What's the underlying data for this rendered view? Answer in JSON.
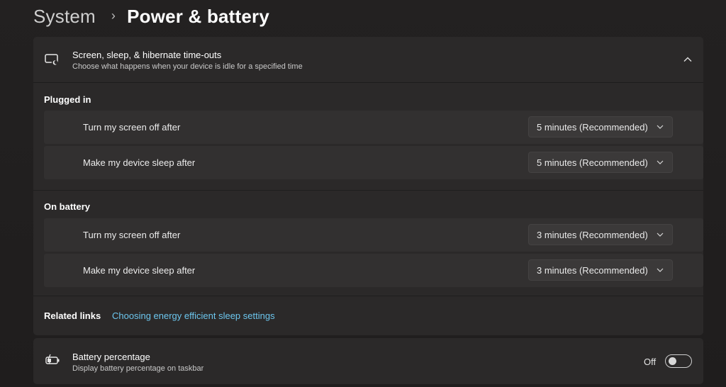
{
  "breadcrumb": {
    "parent": "System",
    "separator": "›",
    "current": "Power & battery"
  },
  "timeouts": {
    "icon": "screen-moon-icon",
    "title": "Screen, sleep, & hibernate time-outs",
    "subtitle": "Choose what happens when your device is idle for a specified time",
    "expanded": true,
    "plugged_in": {
      "label": "Plugged in",
      "screen_off_label": "Turn my screen off after",
      "screen_off_value": "5 minutes (Recommended)",
      "sleep_label": "Make my device sleep after",
      "sleep_value": "5 minutes (Recommended)"
    },
    "on_battery": {
      "label": "On battery",
      "screen_off_label": "Turn my screen off after",
      "screen_off_value": "3 minutes (Recommended)",
      "sleep_label": "Make my device sleep after",
      "sleep_value": "3 minutes (Recommended)"
    },
    "related": {
      "label": "Related links",
      "link": "Choosing energy efficient sleep settings"
    }
  },
  "battery_percentage": {
    "icon": "battery-charging-icon",
    "title": "Battery percentage",
    "subtitle": "Display battery percentage on taskbar",
    "state_label": "Off",
    "enabled": false
  },
  "colors": {
    "background": "#211f1f",
    "card": "#2b2929",
    "row": "#323030",
    "link": "#6cc6ee"
  }
}
